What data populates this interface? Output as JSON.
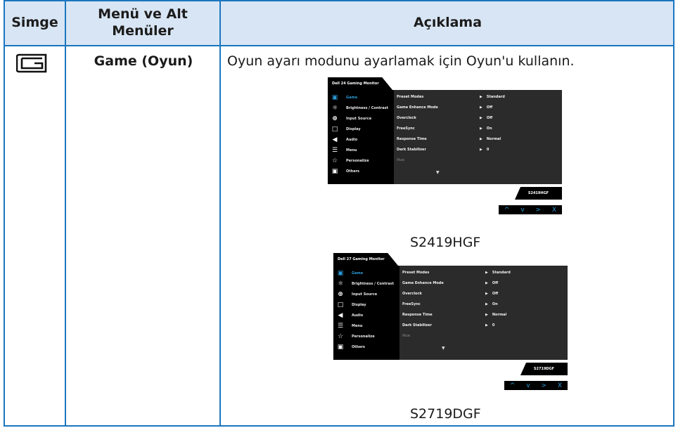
{
  "headers": {
    "simge": "Simge",
    "menu": "Menü ve Alt Menüler",
    "aciklama": "Açıklama"
  },
  "row": {
    "icon": "game-icon",
    "menu_name": "Game (Oyun)",
    "description": "Oyun ayarı modunu ayarlamak için Oyun'u kullanın."
  },
  "osd1": {
    "title": "Dell 24 Gaming Monitor",
    "sidebar": [
      "Game",
      "Brightness / Contrast",
      "Input Source",
      "Display",
      "Audio",
      "Menu",
      "Personalize",
      "Others"
    ],
    "settings": [
      {
        "label": "Preset Modes",
        "value": "Standard"
      },
      {
        "label": "Game Enhance Mode",
        "value": "Off"
      },
      {
        "label": "Overclock",
        "value": "Off"
      },
      {
        "label": "FreeSync",
        "value": "On"
      },
      {
        "label": "Response Time",
        "value": "Normal"
      },
      {
        "label": "Dark Stabilizer",
        "value": "0"
      }
    ],
    "dim_item": "Hue",
    "model": "S2419HGF",
    "caption": "S2419HGF"
  },
  "osd2": {
    "title": "Dell 27 Gaming Monitor",
    "sidebar": [
      "Game",
      "Brightness / Contrast",
      "Input Source",
      "Display",
      "Audio",
      "Menu",
      "Personalize",
      "Others"
    ],
    "settings": [
      {
        "label": "Preset Modes",
        "value": "Standard"
      },
      {
        "label": "Game Enhance Mode",
        "value": "Off"
      },
      {
        "label": "Overclock",
        "value": "Off"
      },
      {
        "label": "FreeSync",
        "value": "On"
      },
      {
        "label": "Response Time",
        "value": "Normal"
      },
      {
        "label": "Dark Stabilizer",
        "value": "0"
      }
    ],
    "dim_item": "Hue",
    "model": "S2719DGF",
    "caption": "S2719DGF"
  },
  "osd_buttons": [
    "^",
    "v",
    ">",
    "X"
  ],
  "sidebar_icons": [
    "game-icon",
    "brightness-icon",
    "input-source-icon",
    "display-icon",
    "audio-icon",
    "menu-icon",
    "personalize-star-icon",
    "others-icon"
  ],
  "colors": {
    "border": "#1a76bf",
    "header_bg": "#d8e5f4",
    "osd_accent": "#2b9bd8"
  }
}
